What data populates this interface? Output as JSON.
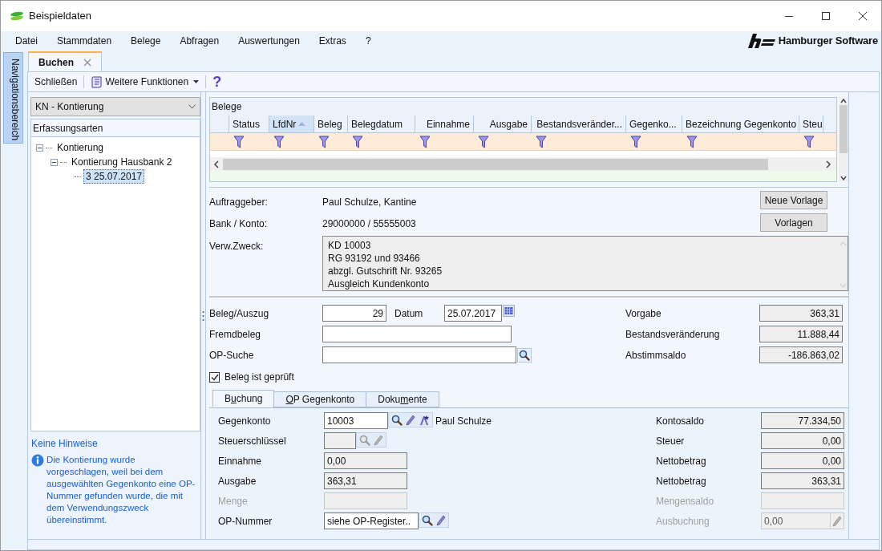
{
  "window": {
    "title": "Beispieldaten"
  },
  "menu": [
    "Datei",
    "Stammdaten",
    "Belege",
    "Abfragen",
    "Auswertungen",
    "Extras",
    "?"
  ],
  "brand": "Hamburger Software",
  "navigation_panel": {
    "label": "Navigationsbereich"
  },
  "document_tabs": [
    {
      "label": "Buchen",
      "selected": true
    }
  ],
  "toolbar": {
    "close": "Schließen",
    "functions": "Weitere Funktionen",
    "help": "?"
  },
  "entry_type": {
    "value": "KN - Kontierung"
  },
  "tree": {
    "title": "Erfassungsarten",
    "items": [
      {
        "label": "Kontierung",
        "expanded": true,
        "selected": false,
        "children": [
          {
            "label": "Kontierung Hausbank 2",
            "expanded": true,
            "selected": false,
            "children": [
              {
                "label": "3 25.07.2017",
                "selected": true
              }
            ]
          }
        ]
      }
    ]
  },
  "hints": {
    "title": "Keine Hinweise",
    "message": "Die Kontierung wurde vorgeschlagen, weil bei dem ausgewählten Gegenkonto eine OP-Nummer gefunden wurde, die mit dem Verwendungszweck übereinstimmt."
  },
  "belege": {
    "title": "Belege",
    "columns": [
      {
        "label": "Status",
        "sorted": false
      },
      {
        "label": "LfdNr",
        "sorted": true
      },
      {
        "label": "Beleg",
        "sorted": false
      },
      {
        "label": "Belegdatum",
        "sorted": false
      },
      {
        "label": "Einnahme",
        "sorted": false
      },
      {
        "label": "Ausgabe",
        "sorted": false
      },
      {
        "label": "Bestandsveränder...",
        "sorted": false
      },
      {
        "label": "Gegenko...",
        "sorted": false
      },
      {
        "label": "Bezeichnung Gegenkonto",
        "sorted": false
      },
      {
        "label": "Steu",
        "sorted": false
      }
    ]
  },
  "payer": {
    "label": "Auftraggeber:",
    "value": "Paul Schulze, Kantine"
  },
  "bank": {
    "label": "Bank / Konto:",
    "value": "29000000 / 55555003"
  },
  "purpose": {
    "label": "Verw.Zweck:",
    "lines": [
      "KD 10003",
      "RG 93192 und 93466",
      "abzgl. Gutschrift Nr. 93265",
      "Ausgleich Kundenkonto"
    ]
  },
  "template_buttons": [
    "Neue Vorlage",
    "Vorlagen"
  ],
  "voucher": {
    "label": "Beleg/Auszug",
    "value": "29"
  },
  "date": {
    "label": "Datum",
    "value": "25.07.2017"
  },
  "external_voucher": {
    "label": "Fremdbeleg"
  },
  "op_search": {
    "label": "OP-Suche"
  },
  "totals": [
    {
      "label": "Vorgabe",
      "value": "363,31"
    },
    {
      "label": "Bestandsveränderung",
      "value": "11.888,44"
    },
    {
      "label": "Abstimmsaldo",
      "value": "-186.863,02"
    }
  ],
  "checked_box": {
    "label": "Beleg ist geprüft",
    "checked": true
  },
  "detail_tabs": [
    {
      "label_start": "B",
      "access_key": "u",
      "label_end": "chung",
      "selected": true
    },
    {
      "access_key": "O",
      "label_end": "P Gegenkonto",
      "selected": false
    },
    {
      "label_start": "Doku",
      "access_key": "m",
      "label_end": "ente",
      "selected": false
    }
  ],
  "booking_fields": [
    {
      "label": "Gegenkonto",
      "value": "10003",
      "readonly": false,
      "disabled": false,
      "tools": [
        {
          "kind": "search",
          "enabled": true
        },
        {
          "kind": "edit",
          "enabled": true
        },
        {
          "kind": "format",
          "enabled": true
        }
      ],
      "note": "Paul Schulze"
    },
    {
      "label": "Steuerschlüssel",
      "readonly": true,
      "disabled": false,
      "tools": [
        {
          "kind": "search",
          "enabled": false
        },
        {
          "kind": "edit",
          "enabled": false
        }
      ]
    },
    {
      "label": "Einnahme",
      "value": "0,00",
      "readonly": true,
      "disabled": false
    },
    {
      "label": "Ausgabe",
      "value": "363,31",
      "readonly": true,
      "disabled": false
    },
    {
      "label": "Menge",
      "readonly": true,
      "disabled": true
    },
    {
      "label": "OP-Nummer",
      "value": "siehe OP-Register..",
      "readonly": false,
      "disabled": false,
      "tools": [
        {
          "kind": "search",
          "enabled": true
        },
        {
          "kind": "edit",
          "enabled": true
        }
      ]
    }
  ],
  "booking_totals": [
    {
      "label": "Kontosaldo",
      "value": "77.334,50",
      "disabled": false
    },
    {
      "label": "Steuer",
      "value": "0,00",
      "disabled": false
    },
    {
      "label": "Nettobetrag",
      "value": "0,00",
      "disabled": false
    },
    {
      "label": "Nettobetrag",
      "value": "363,31",
      "disabled": false
    },
    {
      "label": "Mengensaldo",
      "disabled": true
    },
    {
      "label": "Ausbuchung",
      "value": "0,00",
      "disabled": true,
      "tools": [
        {
          "kind": "edit",
          "enabled": false
        }
      ]
    }
  ]
}
